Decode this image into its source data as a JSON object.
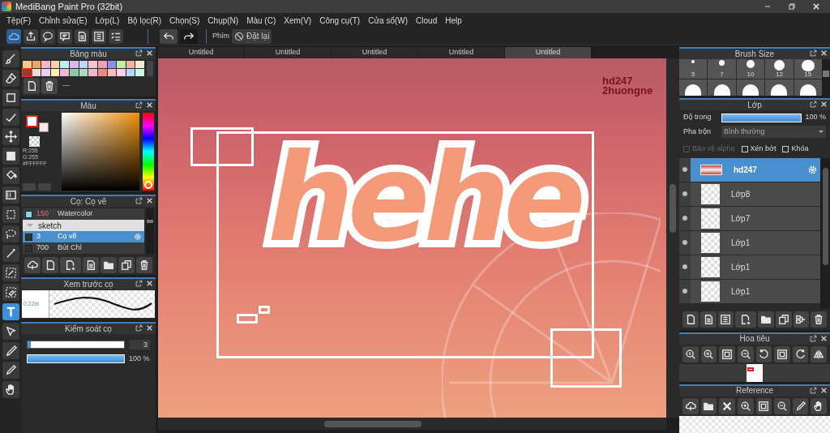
{
  "window": {
    "title": "MediBang Paint Pro (32bit)"
  },
  "menu": [
    "Tệp(F)",
    "Chỉnh sửa(E)",
    "Lớp(L)",
    "Bộ lọc(R)",
    "Chọn(S)",
    "Chụp(N)",
    "Màu (C)",
    "Xem(V)",
    "Công cụ(T)",
    "Cửa sổ(W)",
    "Cloud",
    "Help"
  ],
  "toolbar": {
    "buttons": [
      {
        "kind": "cloud",
        "selected": true
      },
      {
        "kind": "share",
        "selected": false
      },
      {
        "kind": "speech",
        "selected": false
      },
      {
        "kind": "comment",
        "selected": false
      },
      {
        "kind": "page",
        "selected": false
      },
      {
        "kind": "list",
        "selected": false
      },
      {
        "kind": "checklist",
        "selected": false
      }
    ],
    "history": [
      {
        "kind": "undo"
      },
      {
        "kind": "redo"
      }
    ],
    "shortcut_label": "Phím",
    "reset_button": "Đặt lại"
  },
  "tools": [
    {
      "kind": "brush",
      "selected": false
    },
    {
      "kind": "eraser",
      "selected": false
    },
    {
      "kind": "square",
      "selected": false
    },
    {
      "kind": "line",
      "selected": false
    },
    {
      "kind": "move",
      "selected": false
    },
    {
      "kind": "fillrect",
      "selected": false
    },
    {
      "kind": "bucket",
      "selected": false
    },
    {
      "kind": "gradient",
      "selected": false
    },
    {
      "kind": "selrect",
      "selected": false
    },
    {
      "kind": "lasso",
      "selected": false
    },
    {
      "kind": "wand",
      "selected": false
    },
    {
      "kind": "selpen",
      "selected": false
    },
    {
      "kind": "seleraser",
      "selected": false
    },
    {
      "kind": "text",
      "selected": true
    },
    {
      "kind": "pointer",
      "selected": false
    },
    {
      "kind": "pen",
      "selected": false
    },
    {
      "kind": "eyedropper",
      "selected": false
    },
    {
      "kind": "hand",
      "selected": false
    }
  ],
  "palette": {
    "title": "Bảng màu",
    "name": "---",
    "swatches": [
      {
        "color": "#f5c98a",
        "selected": false
      },
      {
        "color": "#f0a860",
        "selected": false
      },
      {
        "color": "#f5b8c8",
        "selected": false
      },
      {
        "color": "#f8d0b0",
        "selected": false
      },
      {
        "color": "#b8f0f0",
        "selected": false
      },
      {
        "color": "#d8b8f0",
        "selected": false
      },
      {
        "color": "#c0d8f8",
        "selected": false
      },
      {
        "color": "#f8c0d0",
        "selected": false
      },
      {
        "color": "#f0a0b0",
        "selected": false
      },
      {
        "color": "#8890f0",
        "selected": false
      },
      {
        "color": "#c0f0a0",
        "selected": false
      },
      {
        "color": "#f8b0a0",
        "selected": false
      },
      {
        "color": "#f8e8d8",
        "selected": false
      },
      {
        "color": "#a03828",
        "selected": true
      },
      {
        "color": "#f8d8d8",
        "selected": false
      },
      {
        "color": "#e8d0f8",
        "selected": false
      },
      {
        "color": "#f8f0b0",
        "selected": false
      },
      {
        "color": "#f0b8d8",
        "selected": false
      },
      {
        "color": "#90c8a8",
        "selected": false
      },
      {
        "color": "#b0d8c8",
        "selected": false
      },
      {
        "color": "#f0b8c0",
        "selected": false
      },
      {
        "color": "#f08888",
        "selected": false
      },
      {
        "color": "#f8c0b0",
        "selected": false
      },
      {
        "color": "#f8d0f0",
        "selected": false
      },
      {
        "color": "#b0d8f8",
        "selected": false
      },
      {
        "color": "#c8f8e8",
        "selected": false
      }
    ]
  },
  "color": {
    "title": "Màu",
    "r": "R:255",
    "g": "G:255",
    "hex": "#FFFFFF"
  },
  "brush": {
    "title": "Cọ: Cọ vẽ",
    "items": [
      {
        "kind": "brush",
        "size": "150",
        "name": "Watercolor",
        "color": "#80d8f8",
        "selected": false
      },
      {
        "kind": "group",
        "name": "sketch",
        "expanded": true
      },
      {
        "kind": "brush",
        "size": "3",
        "name": "Cọ vẽ",
        "color": "#303030",
        "selected": true
      },
      {
        "kind": "brush",
        "size": "700",
        "name": "Bút Chì",
        "color": "#303030",
        "selected": false
      }
    ]
  },
  "preview": {
    "title": "Xem trước cọ",
    "size": "0.22m"
  },
  "brush_control": {
    "title": "Kiểm soát cọ",
    "size": {
      "level": 0.03,
      "value": "3"
    },
    "opacity": {
      "level": 1,
      "reading": "100 %"
    }
  },
  "tabs": [
    {
      "label": "Untitled",
      "selected": false
    },
    {
      "label": "Untitled",
      "selected": false
    },
    {
      "label": "Untitled",
      "selected": false
    },
    {
      "label": "Untitled",
      "selected": false
    },
    {
      "label": "Untitled",
      "selected": true
    }
  ],
  "canvas": {
    "lettering": "hehe",
    "signature": [
      "hd247",
      "2huongne"
    ]
  },
  "brush_size": {
    "title": "Brush Size",
    "sizes": [
      "5",
      "7",
      "10",
      "12",
      "15"
    ]
  },
  "layers": {
    "title": "Lớp",
    "opacity_label": "Độ trong",
    "opacity": {
      "level": 1,
      "reading": "100 %"
    },
    "blend_label": "Pha trộn",
    "blend": "Bình thường",
    "options": [
      {
        "label": "Bảo vệ alpha",
        "checked": false,
        "disabled": true
      },
      {
        "label": "Xén bớt",
        "checked": false,
        "disabled": false
      },
      {
        "label": "Khóa",
        "checked": false,
        "disabled": false
      }
    ],
    "items": [
      {
        "name": "hd247",
        "kind": "art",
        "visible": true,
        "selected": true
      },
      {
        "name": "Lớp8",
        "kind": "empty",
        "visible": true,
        "selected": false
      },
      {
        "name": "Lớp7",
        "kind": "empty",
        "visible": true,
        "selected": false
      },
      {
        "name": "Lớp1",
        "kind": "empty",
        "visible": true,
        "selected": false
      },
      {
        "name": "Lớp1",
        "kind": "empty",
        "visible": true,
        "selected": false
      },
      {
        "name": "Lớp1",
        "kind": "empty",
        "visible": true,
        "selected": false
      }
    ]
  },
  "navigator": {
    "title": "Hoa tiêu"
  },
  "reference": {
    "title": "Reference"
  }
}
